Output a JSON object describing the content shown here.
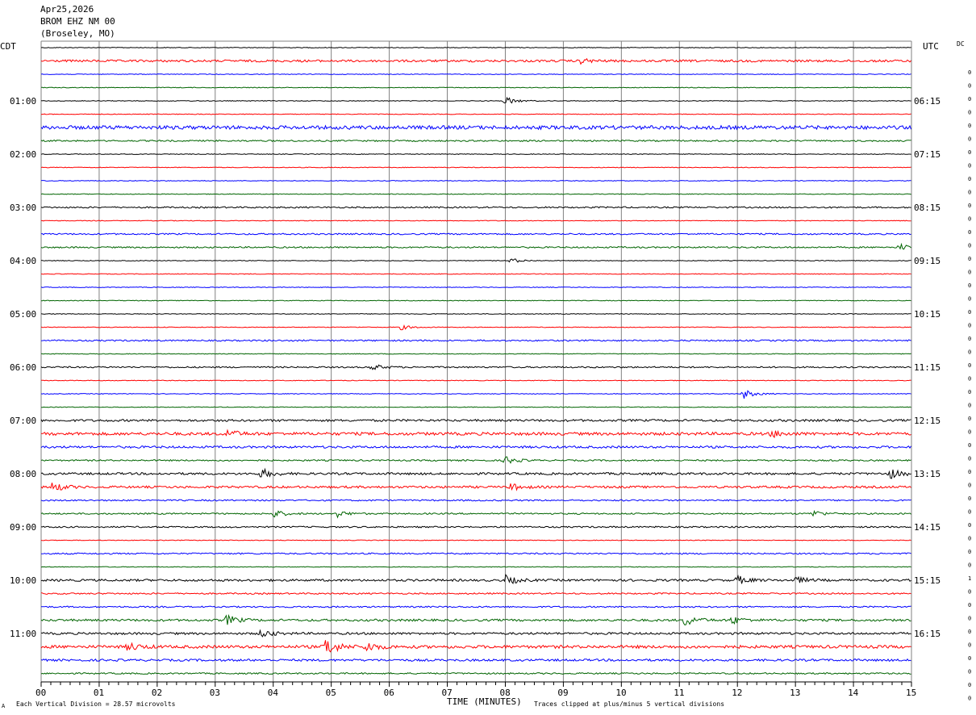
{
  "header": {
    "date": "Apr25,2026",
    "station": "BROM EHZ NM 00",
    "location": "(Broseley, MO)"
  },
  "left_zone_label": "CDT",
  "right_zone_label": "UTC",
  "dc_label": "DC",
  "footer": {
    "vertical_division": "Each Vertical Division =   28.57 microvolts",
    "clip_note": "Traces clipped at plus/minus 5 vertical divisions",
    "corner_mark": "A"
  },
  "colors": {
    "trace_cycle": [
      "#000000",
      "#ff0000",
      "#0000ff",
      "#006400"
    ],
    "grid": "#808080",
    "text": "#000000"
  },
  "chart_data": {
    "type": "line",
    "xlabel": "TIME (MINUTES)",
    "x_ticks": [
      "00",
      "01",
      "02",
      "03",
      "04",
      "05",
      "06",
      "07",
      "08",
      "09",
      "10",
      "11",
      "12",
      "13",
      "14",
      "15"
    ],
    "xlim": [
      0,
      15
    ],
    "trace_count": 48,
    "left_hour_labels": [
      "01:00",
      "02:00",
      "03:00",
      "04:00",
      "05:00",
      "06:00",
      "07:00",
      "08:00",
      "09:00",
      "10:00",
      "11:00"
    ],
    "right_hour_labels": [
      "06:15",
      "07:15",
      "08:15",
      "09:15",
      "10:15",
      "11:15",
      "12:15",
      "13:15",
      "14:15",
      "15:15",
      "16:15"
    ],
    "dc_offsets": [
      "0",
      "0",
      "0",
      "0",
      "0",
      "0",
      "0",
      "0",
      "0",
      "0",
      "0",
      "0",
      "0",
      "0",
      "0",
      "0",
      "0",
      "0",
      "0",
      "0",
      "0",
      "0",
      "0",
      "0",
      "0",
      "0",
      "0",
      "0",
      "0",
      "0",
      "0",
      "0",
      "0",
      "0",
      "0",
      "0",
      "0",
      "0",
      "1",
      "0",
      "0",
      "0",
      "0",
      "0",
      "0",
      "0",
      "0",
      "0"
    ],
    "trace_amplitude": [
      1,
      3,
      1,
      1,
      1,
      1,
      5,
      2,
      1,
      1,
      1,
      1,
      2,
      1,
      2,
      2,
      1,
      1,
      1,
      1,
      1,
      1,
      2,
      1,
      2,
      1,
      1,
      1,
      3,
      4,
      3,
      2,
      3,
      3,
      2,
      2,
      2,
      1,
      2,
      1,
      3,
      2,
      2,
      3,
      3,
      4,
      3,
      2
    ],
    "events": [
      {
        "trace": 1,
        "minute": 9.3,
        "amplitude": 3
      },
      {
        "trace": 4,
        "minute": 8.0,
        "amplitude": 5
      },
      {
        "trace": 15,
        "minute": 14.8,
        "amplitude": 4
      },
      {
        "trace": 16,
        "minute": 8.1,
        "amplitude": 3
      },
      {
        "trace": 21,
        "minute": 6.2,
        "amplitude": 3
      },
      {
        "trace": 24,
        "minute": 5.7,
        "amplitude": 4
      },
      {
        "trace": 26,
        "minute": 12.1,
        "amplitude": 6
      },
      {
        "trace": 29,
        "minute": 3.2,
        "amplitude": 5
      },
      {
        "trace": 29,
        "minute": 12.6,
        "amplitude": 4
      },
      {
        "trace": 31,
        "minute": 8.0,
        "amplitude": 5
      },
      {
        "trace": 32,
        "minute": 3.8,
        "amplitude": 6
      },
      {
        "trace": 32,
        "minute": 14.6,
        "amplitude": 7
      },
      {
        "trace": 33,
        "minute": 0.2,
        "amplitude": 6
      },
      {
        "trace": 33,
        "minute": 8.1,
        "amplitude": 4
      },
      {
        "trace": 35,
        "minute": 4.0,
        "amplitude": 5
      },
      {
        "trace": 35,
        "minute": 5.1,
        "amplitude": 4
      },
      {
        "trace": 35,
        "minute": 13.3,
        "amplitude": 4
      },
      {
        "trace": 40,
        "minute": 8.0,
        "amplitude": 6
      },
      {
        "trace": 40,
        "minute": 12.0,
        "amplitude": 5
      },
      {
        "trace": 40,
        "minute": 13.0,
        "amplitude": 4
      },
      {
        "trace": 43,
        "minute": 3.2,
        "amplitude": 6
      },
      {
        "trace": 43,
        "minute": 11.1,
        "amplitude": 7
      },
      {
        "trace": 43,
        "minute": 11.9,
        "amplitude": 5
      },
      {
        "trace": 44,
        "minute": 3.8,
        "amplitude": 5
      },
      {
        "trace": 45,
        "minute": 1.5,
        "amplitude": 5
      },
      {
        "trace": 45,
        "minute": 4.9,
        "amplitude": 12
      },
      {
        "trace": 45,
        "minute": 5.6,
        "amplitude": 6
      }
    ]
  }
}
